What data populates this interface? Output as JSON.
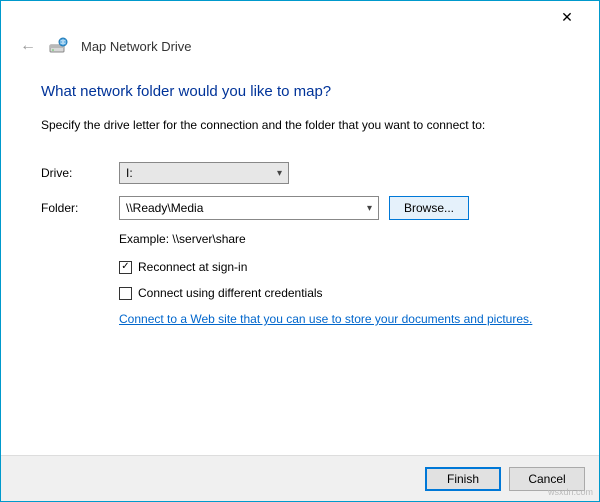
{
  "window": {
    "title": "Map Network Drive"
  },
  "heading": "What network folder would you like to map?",
  "instruction": "Specify the drive letter for the connection and the folder that you want to connect to:",
  "labels": {
    "drive": "Drive:",
    "folder": "Folder:"
  },
  "drive": {
    "value": "I:"
  },
  "folder": {
    "value": "\\\\Ready\\Media"
  },
  "browse": "Browse...",
  "example": "Example: \\\\server\\share",
  "checkboxes": {
    "reconnect": {
      "label": "Reconnect at sign-in",
      "checked": true
    },
    "credentials": {
      "label": "Connect using different credentials",
      "checked": false
    }
  },
  "link": "Connect to a Web site that you can use to store your documents and pictures.",
  "buttons": {
    "finish": "Finish",
    "cancel": "Cancel"
  },
  "watermark": "wsxdn.com"
}
